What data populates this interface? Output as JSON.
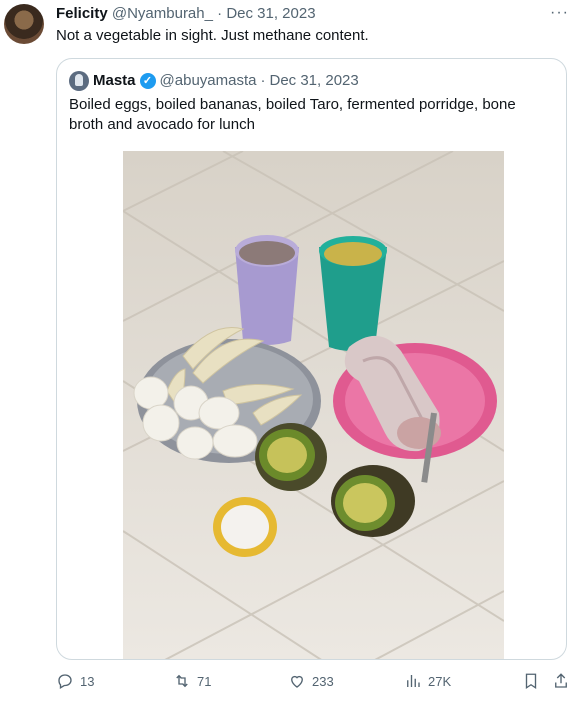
{
  "tweet": {
    "author_name": "Felicity",
    "handle": "@Nyamburah_",
    "separator": "·",
    "date": "Dec 31, 2023",
    "more_label": "···",
    "text": "Not a vegetable in sight. Just methane content."
  },
  "quoted": {
    "author_name": "Masta",
    "verified_mark": "✓",
    "handle": "@abuyamasta",
    "separator": "·",
    "date": "Dec 31, 2023",
    "text": "Boiled eggs, boiled bananas, boiled Taro, fermented porridge, bone broth and avocado for lunch"
  },
  "actions": {
    "replies": "13",
    "retweets": "71",
    "likes": "233",
    "views": "27K"
  },
  "icons": [
    "reply-icon",
    "retweet-icon",
    "like-icon",
    "views-icon",
    "bookmark-icon",
    "share-icon"
  ],
  "colors": {
    "accent": "#1d9bf0",
    "muted": "#536471",
    "border": "#cfd9de"
  }
}
